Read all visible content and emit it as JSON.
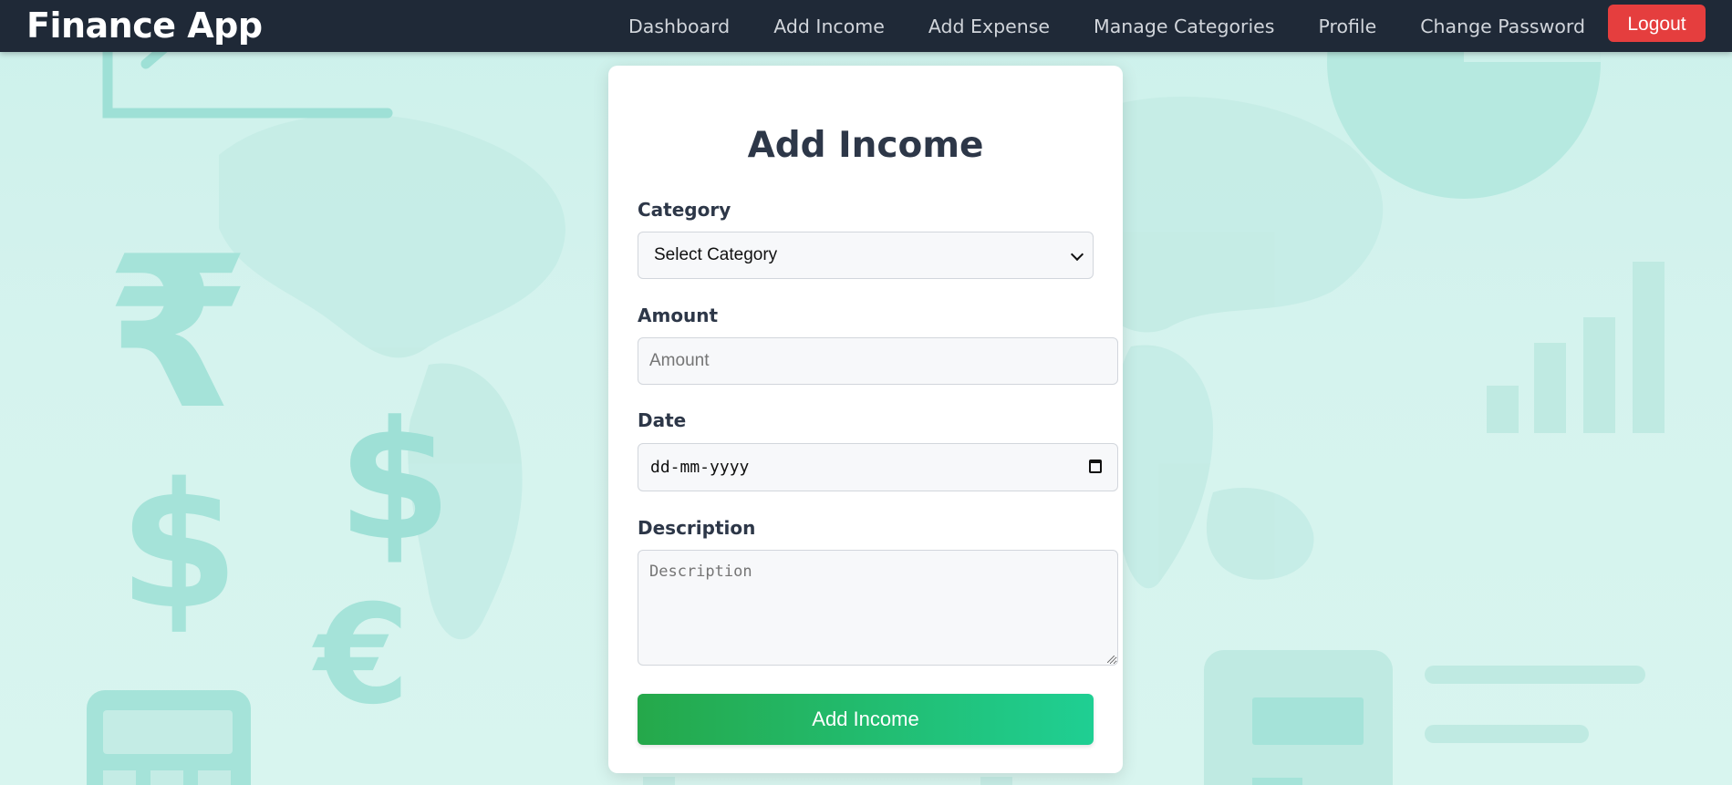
{
  "nav": {
    "brand": "Finance App",
    "links": [
      {
        "label": "Dashboard"
      },
      {
        "label": "Add Income"
      },
      {
        "label": "Add Expense"
      },
      {
        "label": "Manage Categories"
      },
      {
        "label": "Profile"
      },
      {
        "label": "Change Password"
      }
    ],
    "logout_label": "Logout"
  },
  "form": {
    "title": "Add Income",
    "category": {
      "label": "Category",
      "selected": "Select Category"
    },
    "amount": {
      "label": "Amount",
      "placeholder": "Amount",
      "value": ""
    },
    "date": {
      "label": "Date",
      "display": "dd-mm-yyyy"
    },
    "description": {
      "label": "Description",
      "placeholder": "Description",
      "value": ""
    },
    "submit_label": "Add Income"
  },
  "colors": {
    "navbar": "#1f2937",
    "logout": "#e53e3e",
    "submit_start": "#25a84a",
    "submit_end": "#1fcf93",
    "background": "#cdf1eb",
    "heading": "#2d3748"
  },
  "background_icons": [
    "trend-chart-icon",
    "pie-chart-icon",
    "rupee-icon",
    "dollar-icon",
    "euro-icon",
    "bar-chart-icon",
    "calculator-icon",
    "world-map"
  ]
}
